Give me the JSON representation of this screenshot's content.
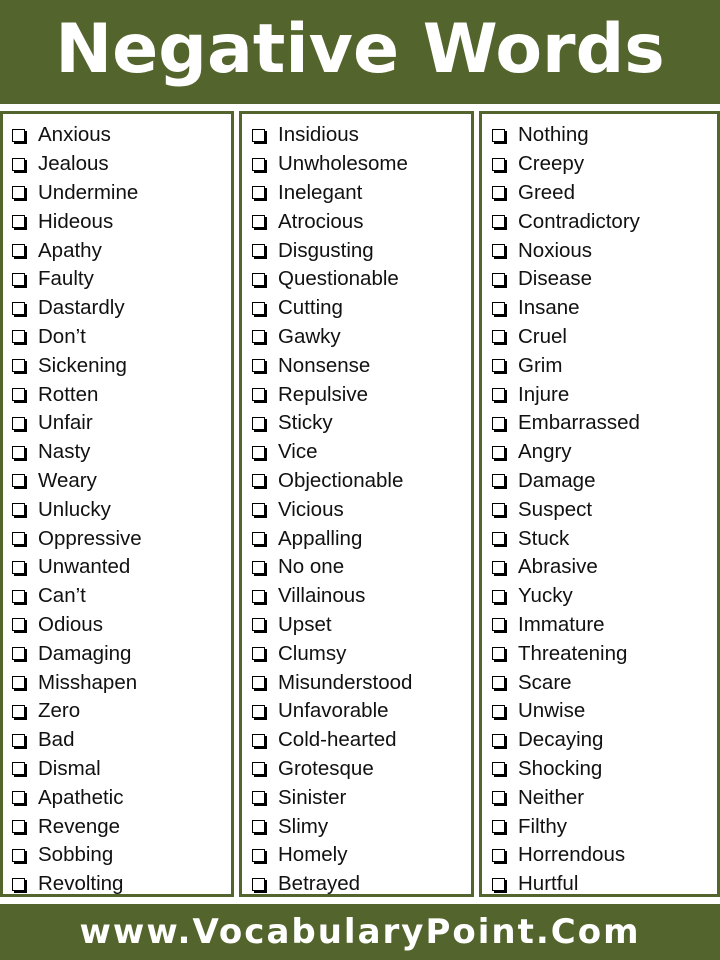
{
  "header": {
    "title": "Negative Words"
  },
  "colors": {
    "brand_green": "#53652c",
    "text": "#111111",
    "background": "#ffffff"
  },
  "columns": [
    {
      "items": [
        "Anxious",
        "Jealous",
        "Undermine",
        "Hideous",
        "Apathy",
        "Faulty",
        "Dastardly",
        "Don’t",
        "Sickening",
        "Rotten",
        "Unfair",
        "Nasty",
        "Weary",
        "Unlucky",
        "Oppressive",
        "Unwanted",
        "Can’t",
        "Odious",
        "Damaging",
        "Misshapen",
        "Zero",
        "Bad",
        "Dismal",
        "Apathetic",
        "Revenge",
        "Sobbing",
        "Revolting"
      ]
    },
    {
      "items": [
        "Insidious",
        "Unwholesome",
        "Inelegant",
        "Atrocious",
        "Disgusting",
        "Questionable",
        "Cutting",
        "Gawky",
        "Nonsense",
        "Repulsive",
        "Sticky",
        "Vice",
        "Objectionable",
        "Vicious",
        "Appalling",
        "No one",
        "Villainous",
        "Upset",
        "Clumsy",
        "Misunderstood",
        "Unfavorable",
        "Cold-hearted",
        "Grotesque",
        "Sinister",
        "Slimy",
        "Homely",
        "Betrayed"
      ]
    },
    {
      "items": [
        "Nothing",
        "Creepy",
        "Greed",
        "Contradictory",
        "Noxious",
        "Disease",
        "Insane",
        "Cruel",
        "Grim",
        "Injure",
        "Embarrassed",
        "Angry",
        "Damage",
        "Suspect",
        "Stuck",
        "Abrasive",
        "Yucky",
        "Immature",
        "Threatening",
        "Scare",
        "Unwise",
        "Decaying",
        "Shocking",
        "Neither",
        "Filthy",
        "Horrendous",
        "Hurtful"
      ]
    }
  ],
  "footer": {
    "url": "www.VocabularyPoint.Com"
  }
}
